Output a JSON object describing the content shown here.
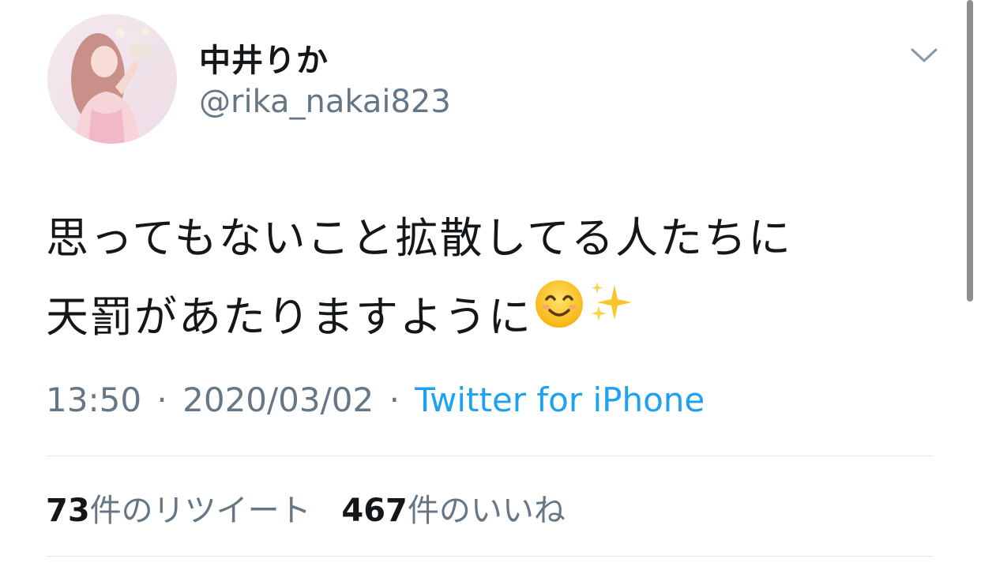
{
  "user": {
    "display_name": "中井りか",
    "handle": "@rika_nakai823"
  },
  "tweet": {
    "line1": "思ってもないこと拡散してる人たちに",
    "line2": "天罰があたりますように",
    "emojis": [
      "smiling-face-icon",
      "sparkles-icon"
    ]
  },
  "meta": {
    "time": "13:50",
    "separator": "·",
    "date": "2020/03/02",
    "source": "Twitter for iPhone"
  },
  "stats": {
    "retweets": {
      "count": "73",
      "label": "件のリツイート"
    },
    "likes": {
      "count": "467",
      "label": "件のいいね"
    }
  },
  "colors": {
    "text": "#14171a",
    "secondary": "#657786",
    "link": "#1da1f2",
    "divider": "#e1e8ed"
  }
}
